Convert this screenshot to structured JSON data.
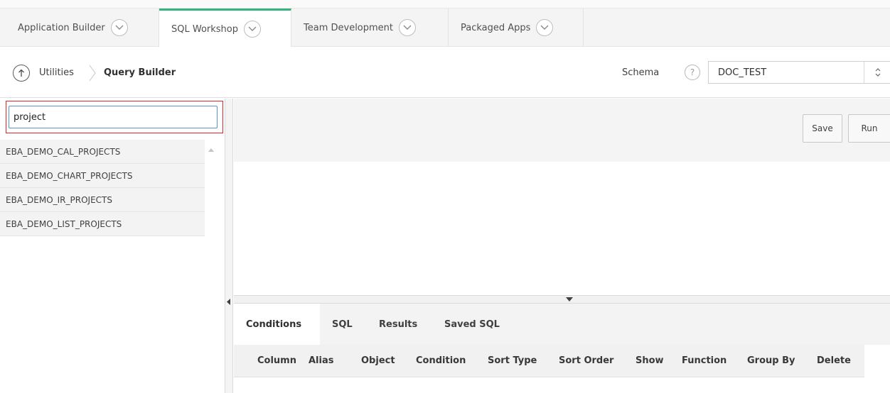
{
  "top_tabs": [
    {
      "label": "Application Builder",
      "active": false
    },
    {
      "label": "SQL Workshop",
      "active": true
    },
    {
      "label": "Team Development",
      "active": false
    },
    {
      "label": "Packaged Apps",
      "active": false
    }
  ],
  "breadcrumb": {
    "parent": "Utilities",
    "current": "Query Builder"
  },
  "schema": {
    "label": "Schema",
    "help": "?",
    "value": "DOC_TEST"
  },
  "search": {
    "value": "project"
  },
  "tables": [
    "EBA_DEMO_CAL_PROJECTS",
    "EBA_DEMO_CHART_PROJECTS",
    "EBA_DEMO_IR_PROJECTS",
    "EBA_DEMO_LIST_PROJECTS"
  ],
  "toolbar": {
    "save_label": "Save",
    "run_label": "Run"
  },
  "bottom_tabs": [
    {
      "label": "Conditions",
      "active": true
    },
    {
      "label": "SQL",
      "active": false
    },
    {
      "label": "Results",
      "active": false
    },
    {
      "label": "Saved SQL",
      "active": false
    }
  ],
  "grid_columns": [
    "Column",
    "Alias",
    "Object",
    "Condition",
    "Sort Type",
    "Sort Order",
    "Show",
    "Function",
    "Group By",
    "Delete"
  ],
  "colors": {
    "active_tab_accent": "#36b37e",
    "search_highlight": "#e0262d"
  }
}
